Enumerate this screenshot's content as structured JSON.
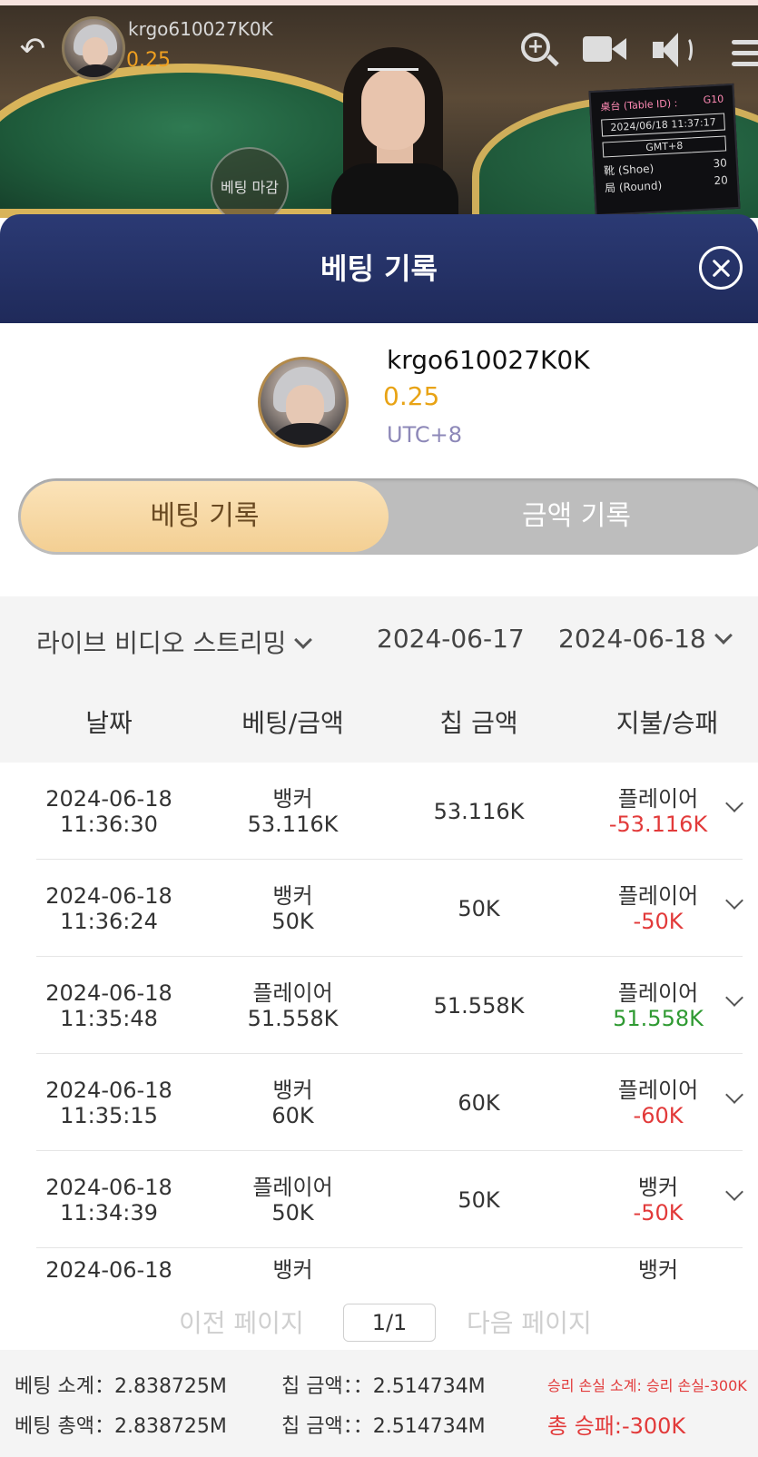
{
  "video": {
    "username": "krgo610027K0K",
    "balance": "0.25",
    "bet_closed": "베팅 마감",
    "table_info": {
      "table_label": "桌台 (Table ID) :",
      "table_id": "G10",
      "datetime": "2024/06/18 11:37:17",
      "gmt": "GMT+8",
      "shoe_label": "靴 (Shoe)",
      "shoe_value": "30",
      "round_label": "局 (Round)",
      "round_value": "20"
    }
  },
  "modal": {
    "title": "베팅 기록"
  },
  "profile": {
    "username": "krgo610027K0K",
    "balance": "0.25",
    "timezone": "UTC+8"
  },
  "tabs": [
    {
      "label": "베팅 기록",
      "active": true
    },
    {
      "label": "금액 기록",
      "active": false
    }
  ],
  "filters": {
    "game": "라이브 비디오 스트리밍",
    "date_from": "2024-06-17",
    "date_to": "2024-06-18"
  },
  "columns": [
    "날짜",
    "베팅/금액",
    "칩 금액",
    "지불/승패"
  ],
  "rows": [
    {
      "date": "2024-06-18",
      "time": "11:36:30",
      "bet_side": "뱅커",
      "bet_amount": "53.116K",
      "chip": "53.116K",
      "result_side": "플레이어",
      "payout": "-53.116K",
      "payout_sign": "neg"
    },
    {
      "date": "2024-06-18",
      "time": "11:36:24",
      "bet_side": "뱅커",
      "bet_amount": "50K",
      "chip": "50K",
      "result_side": "플레이어",
      "payout": "-50K",
      "payout_sign": "neg"
    },
    {
      "date": "2024-06-18",
      "time": "11:35:48",
      "bet_side": "플레이어",
      "bet_amount": "51.558K",
      "chip": "51.558K",
      "result_side": "플레이어",
      "payout": "51.558K",
      "payout_sign": "pos"
    },
    {
      "date": "2024-06-18",
      "time": "11:35:15",
      "bet_side": "뱅커",
      "bet_amount": "60K",
      "chip": "60K",
      "result_side": "플레이어",
      "payout": "-60K",
      "payout_sign": "neg"
    },
    {
      "date": "2024-06-18",
      "time": "11:34:39",
      "bet_side": "플레이어",
      "bet_amount": "50K",
      "chip": "50K",
      "result_side": "뱅커",
      "payout": "-50K",
      "payout_sign": "neg"
    },
    {
      "date": "2024-06-18",
      "time": "",
      "bet_side": "뱅커",
      "bet_amount": "",
      "chip": "",
      "result_side": "뱅커",
      "payout": "",
      "payout_sign": "neg"
    }
  ],
  "pagination": {
    "prev": "이전 페이지",
    "page": "1/1",
    "next": "다음 페이지"
  },
  "summary": {
    "bet_subtotal": "베팅 소계：2.838725M",
    "chip_subtotal": "칩 금액：：2.514734M",
    "winloss_subtotal": "승리 손실 소계: 승리 손실-300K",
    "bet_total": "베팅 총액：2.838725M",
    "chip_total": "칩 금액：：2.514734M",
    "winloss_total": "총 승패:-300K"
  },
  "colors": {
    "header": "#2b3a74",
    "tab_active": "#f3cf93",
    "balance": "#e8a315",
    "negative": "#e23a3a",
    "positive": "#2f9a32"
  }
}
